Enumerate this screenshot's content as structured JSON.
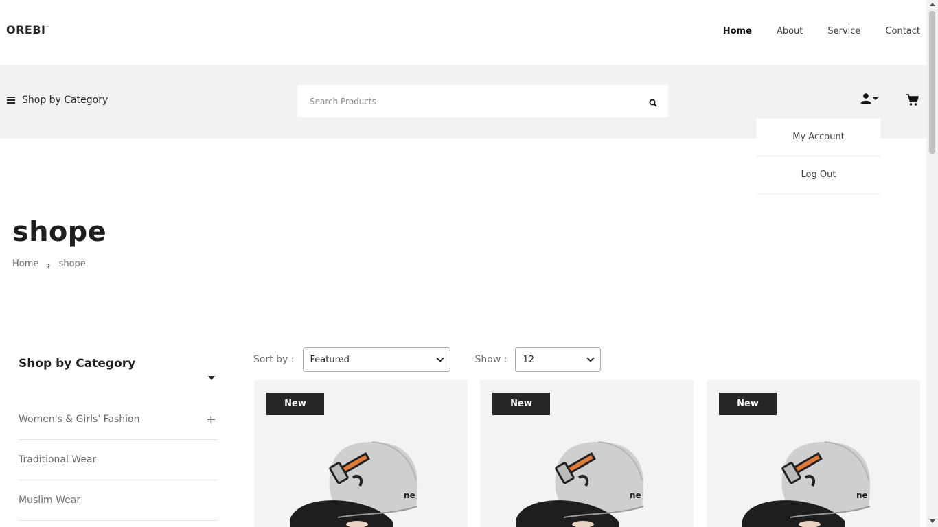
{
  "brand": {
    "logo": "OREBI"
  },
  "nav": {
    "links": [
      {
        "label": "Home",
        "active": true
      },
      {
        "label": "About",
        "active": false
      },
      {
        "label": "Service",
        "active": false
      },
      {
        "label": "Contact",
        "active": false
      }
    ]
  },
  "header": {
    "category_button": "Shop by Category",
    "search_placeholder": "Search Products",
    "icons": {
      "menu": "hamburger-icon",
      "search": "search-icon",
      "user": "user-icon",
      "cart": "cart-icon"
    }
  },
  "account_menu": {
    "items": [
      "My Account",
      "Log Out"
    ]
  },
  "page": {
    "title": "shope",
    "breadcrumb": {
      "home": "Home",
      "current": "shope"
    }
  },
  "sidebar": {
    "title": "Shop by Category",
    "items": [
      {
        "label": "Women's & Girls' Fashion",
        "expandable": true
      },
      {
        "label": "Traditional Wear",
        "expandable": false
      },
      {
        "label": "Muslim Wear",
        "expandable": false
      }
    ]
  },
  "controls": {
    "sort_label": "Sort by :",
    "sort_value": "Featured",
    "show_label": "Show :",
    "show_value": "12"
  },
  "products": [
    {
      "badge": "New"
    },
    {
      "badge": "New"
    },
    {
      "badge": "New"
    }
  ],
  "colors": {
    "band": "#f2f2f2",
    "badge": "#262626",
    "card": "#f3f3f3"
  }
}
